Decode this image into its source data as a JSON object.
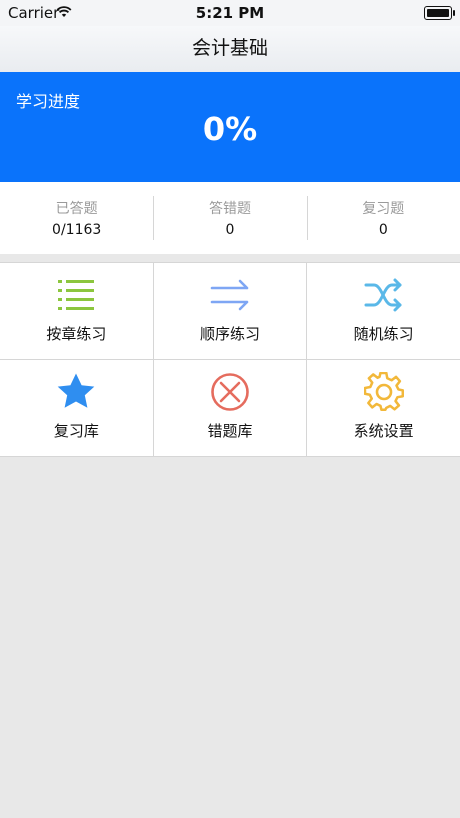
{
  "status": {
    "carrier": "Carrier",
    "time": "5:21 PM"
  },
  "nav": {
    "title": "会计基础"
  },
  "progress": {
    "label": "学习进度",
    "value": "0%"
  },
  "stats": [
    {
      "label": "已答题",
      "value": "0/1163"
    },
    {
      "label": "答错题",
      "value": "0"
    },
    {
      "label": "复习题",
      "value": "0"
    }
  ],
  "menu": [
    {
      "label": "按章练习",
      "icon": "list-icon",
      "color": "#8cc63e"
    },
    {
      "label": "顺序练习",
      "icon": "arrows-right-icon",
      "color": "#7ea6f4"
    },
    {
      "label": "随机练习",
      "icon": "shuffle-icon",
      "color": "#5ab8e8"
    },
    {
      "label": "复习库",
      "icon": "star-icon",
      "color": "#2f8ef0"
    },
    {
      "label": "错题库",
      "icon": "close-circle-icon",
      "color": "#e56c5e"
    },
    {
      "label": "系统设置",
      "icon": "gear-icon",
      "color": "#f2b83a"
    }
  ],
  "colors": {
    "accent": "#0a73fb",
    "background": "#e8e8e8"
  }
}
